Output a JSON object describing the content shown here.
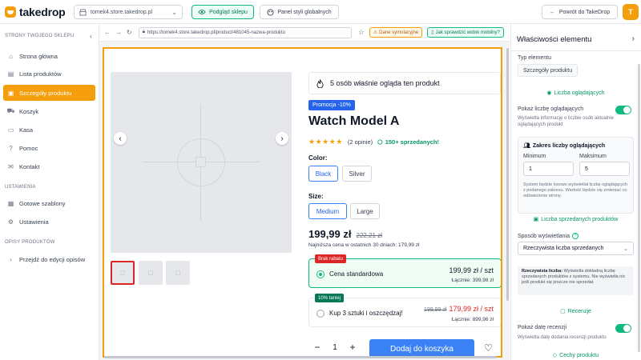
{
  "brand": {
    "name": "takedrop"
  },
  "header": {
    "store": "tomek4.store.takedrop.pl",
    "preview_label": "Podgląd sklepu",
    "styles_label": "Panel styli globalnych",
    "back_label": "Powrót do TakeDrop",
    "avatar_initial": "T"
  },
  "sidebar": {
    "section_store": "STRONY TWOJEGO SKLEPU",
    "items": [
      {
        "label": "Strona główna",
        "icon": "store-icon"
      },
      {
        "label": "Lista produktów",
        "icon": "list-icon"
      },
      {
        "label": "Szczegóły produktu",
        "icon": "product-icon",
        "active": true
      },
      {
        "label": "Koszyk",
        "icon": "cart-icon"
      },
      {
        "label": "Kasa",
        "icon": "register-icon"
      },
      {
        "label": "Pomoc",
        "icon": "help-icon"
      },
      {
        "label": "Kontakt",
        "icon": "contact-icon"
      }
    ],
    "section_settings": "USTAWIENIA",
    "settings_items": [
      {
        "label": "Gotowe szablony",
        "icon": "templates-icon"
      },
      {
        "label": "Ustawienia",
        "icon": "gear-icon"
      }
    ],
    "section_desc": "OPISY PRODUKTÓW",
    "desc_item": "Przejdź do edycji opisów"
  },
  "browser": {
    "url": "https://tomek4.store.takedrop.pl/product/481045-nazwa-produktu",
    "sim_label": "Dane symulacyjne",
    "mobile_label": "Jak sprawdzić widok mobilny?"
  },
  "product": {
    "viewers_text": "5 osób właśnie ogląda ten produkt",
    "promo": "Promocja -10%",
    "title": "Watch Model A",
    "rating_value": 5,
    "reviews": "(2 opinie)",
    "sold": "150+ sprzedanych!",
    "color_label": "Color:",
    "colors": [
      "Black",
      "Silver"
    ],
    "size_label": "Size:",
    "sizes": [
      "Medium",
      "Large"
    ],
    "price": "199,99 zł",
    "old_price": "222,21 zł",
    "lowest_price": "Najniższa cena w ostatnich 30 dniach: 179,99 zł",
    "tiers": [
      {
        "tag": "Brak rabatu",
        "name": "Cena standardowa",
        "price": "199,99 zł / szt",
        "total": "Łącznie: 399,98 zł"
      },
      {
        "tag": "10% taniej",
        "name": "Kup 3 sztuki i oszczędzaj!",
        "old": "199,99 zł",
        "price": "179,99 zł / szt",
        "total": "Łącznie: 899,96 zł"
      }
    ],
    "qty": "1",
    "add_to_cart": "Dodaj do koszyka"
  },
  "panel": {
    "title": "Właściwości elementu",
    "type_label": "Typ elementu",
    "type_value": "Szczegóły produktu",
    "link_viewers": "Liczba oglądających",
    "show_viewers_label": "Pokaż liczbę oglądających",
    "show_viewers_desc": "Wyświetla informację o liczbie osób aktualnie oglądających produkt",
    "range_title": "Zakres liczby oglądających",
    "min_label": "Minimum",
    "max_label": "Maksimum",
    "min_value": "1",
    "max_value": "5",
    "range_note": "System będzie losowo wyświetlał liczbę oglądających z podanego zakresu. Wartość będzie się zmieniać co odświeżenie strony.",
    "link_sold": "Liczba sprzedanych produktów",
    "display_mode_label": "Sposób wyświetlania",
    "display_mode_value": "Rzeczywista liczba sprzedanych",
    "info_bold": "Rzeczywista liczba:",
    "info_text": " Wyświetla dokładną liczbę sprzedanych produktów z systemu. Nie wyświetla nic jeśli produkt się jeszcze nie sprzedał.",
    "link_reviews": "Recenzje",
    "show_review_date_label": "Pokaż datę recenzji",
    "show_review_date_desc": "Wyświetla datę dodania recenzji produktu",
    "link_features": "Cechy produktu"
  },
  "colors": {
    "accent": "#f59e0b",
    "primary": "#3b82f6",
    "success": "#10b981"
  }
}
